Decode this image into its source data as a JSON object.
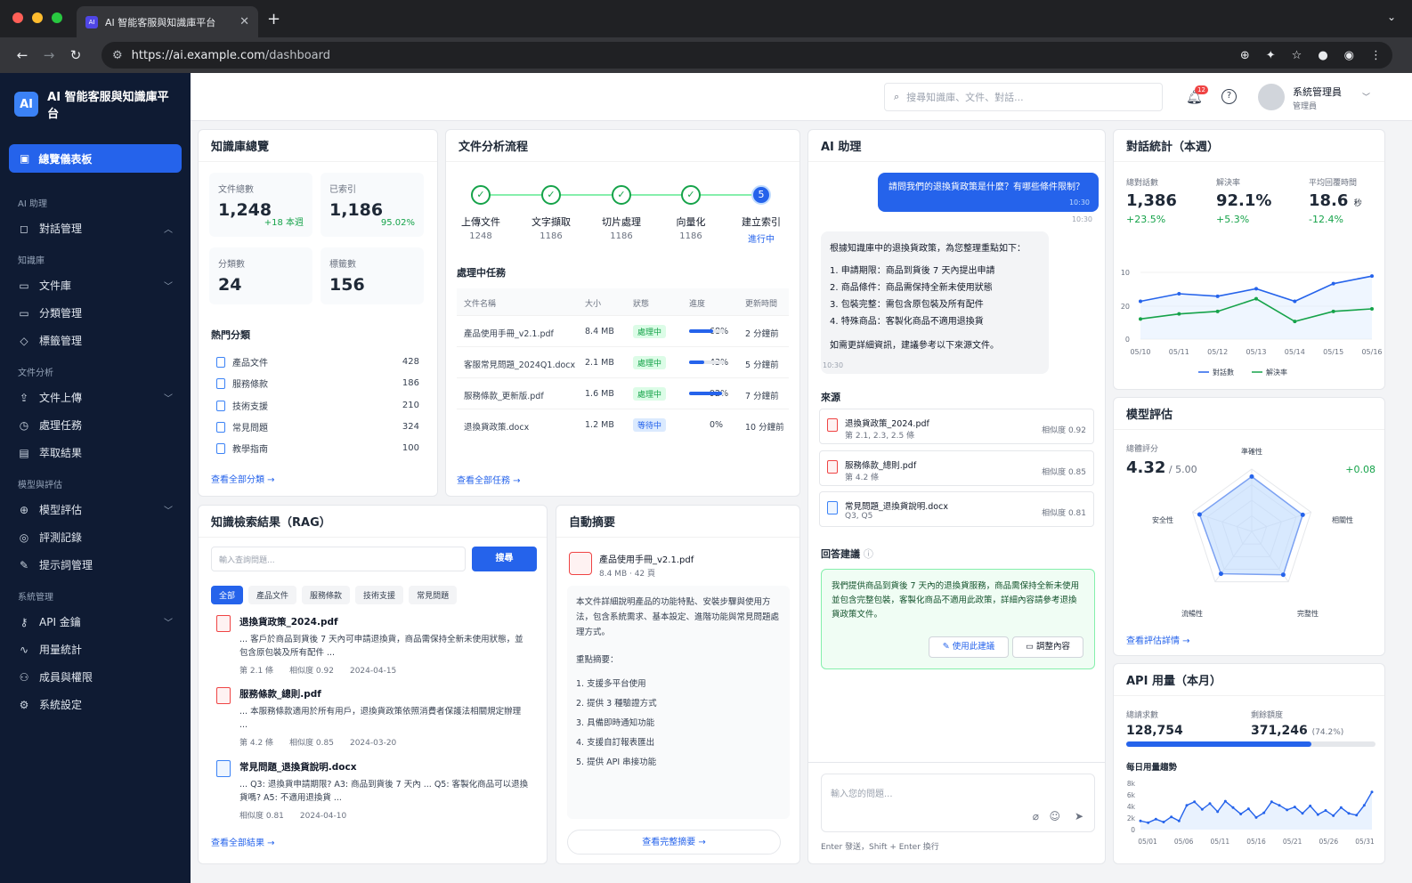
{
  "browser": {
    "tab_title": "AI 智能客服與知識庫平台",
    "favicon": "AI",
    "url_host": "https://ai.example.com",
    "url_path": "/dashboard"
  },
  "app": {
    "logo": "AI",
    "title": "AI 智能客服與知識庫平台"
  },
  "sidebar": {
    "active": "總覽儀表板",
    "sections": [
      {
        "title": "AI 助理",
        "items": [
          "對話管理"
        ]
      },
      {
        "title": "知識庫",
        "items": [
          "文件庫",
          "分類管理",
          "標籤管理"
        ]
      },
      {
        "title": "文件分析",
        "items": [
          "文件上傳",
          "處理任務",
          "萃取結果"
        ]
      },
      {
        "title": "模型與評估",
        "items": [
          "模型評估",
          "評測記錄",
          "提示詞管理"
        ]
      },
      {
        "title": "系統管理",
        "items": [
          "API 金鑰",
          "用量統計",
          "成員與權限",
          "系統設定"
        ]
      }
    ]
  },
  "topbar": {
    "search_placeholder": "搜尋知識庫、文件、對話...",
    "notif_count": "12",
    "user_name": "系統管理員",
    "user_role": "管理員"
  },
  "kb": {
    "title": "知識庫總覽",
    "total_label": "文件總數",
    "total": "1,248",
    "total_delta": "+18 本週",
    "indexed_label": "已索引",
    "indexed": "1,186",
    "indexed_pct": "95.02%",
    "cat_label": "分類數",
    "cat": "24",
    "tag_label": "標籤數",
    "tag": "156",
    "hot_title": "熱門分類",
    "hot": [
      {
        "name": "產品文件",
        "n": "428"
      },
      {
        "name": "服務條款",
        "n": "186"
      },
      {
        "name": "技術支援",
        "n": "210"
      },
      {
        "name": "常見問題",
        "n": "324"
      },
      {
        "name": "教學指南",
        "n": "100"
      }
    ],
    "link": "查看全部分類 →"
  },
  "pipeline": {
    "title": "文件分析流程",
    "steps": [
      {
        "label": "上傳文件",
        "n": "1248"
      },
      {
        "label": "文字擷取",
        "n": "1186"
      },
      {
        "label": "切片處理",
        "n": "1186"
      },
      {
        "label": "向量化",
        "n": "1186"
      },
      {
        "label": "建立索引",
        "n": "進行中"
      }
    ],
    "step5": "5",
    "tasks_title": "處理中任務",
    "headers": [
      "文件名稱",
      "大小",
      "狀態",
      "進度",
      "更新時間"
    ],
    "rows": [
      {
        "name": "產品使用手冊_v2.1.pdf",
        "size": "8.4 MB",
        "status": "處理中",
        "pct": "68%",
        "p": 68,
        "time": "2 分鐘前"
      },
      {
        "name": "客服常見問題_2024Q1.docx",
        "size": "2.1 MB",
        "status": "處理中",
        "pct": "43%",
        "p": 43,
        "time": "5 分鐘前"
      },
      {
        "name": "服務條款_更新版.pdf",
        "size": "1.6 MB",
        "status": "處理中",
        "pct": "92%",
        "p": 92,
        "time": "7 分鐘前"
      },
      {
        "name": "退換貨政策.docx",
        "size": "1.2 MB",
        "status": "等待中",
        "pct": "0%",
        "p": 0,
        "time": "10 分鐘前"
      }
    ],
    "link": "查看全部任務 →"
  },
  "assistant": {
    "title": "AI 助理",
    "user_msg": "請問我們的退換貨政策是什麼？有哪些條件限制？",
    "user_time": "10:30",
    "user_time2": "10:30",
    "reply_intro": "根據知識庫中的退換貨政策，為您整理重點如下：",
    "reply_points": [
      "1.  申請期限：商品到貨後 7 天內提出申請",
      "2.  商品條件：商品需保持全新未使用狀態",
      "3.  包裝完整：需包含原包裝及所有配件",
      "4.  特殊商品：客製化商品不適用退換貨"
    ],
    "reply_outro": "如需更詳細資訊，建議參考以下來源文件。",
    "reply_time": "10:30",
    "src_title": "來源",
    "sources": [
      {
        "name": "退換貨政策_2024.pdf",
        "sec": "第 2.1, 2.3, 2.5 條",
        "score": "相似度 0.92"
      },
      {
        "name": "服務條款_總則.pdf",
        "sec": "第 4.2 條",
        "score": "相似度 0.85"
      },
      {
        "name": "常見問題_退換貨說明.docx",
        "sec": "Q3, Q5",
        "score": "相似度 0.81"
      }
    ],
    "sugg_title": "回答建議",
    "sugg_text": "我們提供商品到貨後 7 天內的退換貨服務，商品需保持全新未使用並包含完整包裝，客製化商品不適用此政策，詳細內容請參考退換貨政策文件。",
    "use_btn": "使用此建議",
    "edit_btn": "調整內容",
    "input_placeholder": "輸入您的問題...",
    "input_hint": "Enter 發送，Shift + Enter 換行"
  },
  "conv": {
    "title": "對話統計（本週）",
    "total_label": "總對話數",
    "total": "1,386",
    "total_c": "+23.5%",
    "rate_label": "解決率",
    "rate": "92.1%",
    "rate_c": "+5.3%",
    "rt_label": "平均回覆時間",
    "rt": "18.6",
    "rt_unit": "秒",
    "rt_c": "-12.4%",
    "legend": [
      "對話數",
      "解決率"
    ]
  },
  "chart_data": [
    {
      "type": "line",
      "x": [
        "05/10",
        "05/11",
        "05/12",
        "05/13",
        "05/14",
        "05/15",
        "05/16"
      ],
      "ylim": [
        0,
        30
      ],
      "yticks": [
        "10",
        "20",
        "0"
      ],
      "series": [
        {
          "name": "對話數",
          "values": [
            15,
            18,
            17,
            20,
            15,
            22,
            25
          ]
        },
        {
          "name": "解決率",
          "values": [
            8,
            10,
            11,
            16,
            7,
            11,
            12
          ]
        }
      ]
    },
    {
      "type": "radar",
      "categories": [
        "準確性",
        "相關性",
        "完整性",
        "流暢性",
        "安全性"
      ],
      "values": [
        4.4,
        4.3,
        4.3,
        4.2,
        4.4
      ],
      "max": 5
    },
    {
      "type": "area",
      "x": [
        "05/01",
        "05/06",
        "05/11",
        "05/16",
        "05/21",
        "05/26",
        "05/31"
      ],
      "ylim": [
        0,
        8
      ],
      "yticks": [
        "8k",
        "6k",
        "4k",
        "2k",
        "0"
      ],
      "values": [
        1.5,
        1.2,
        1.8,
        1.3,
        2.2,
        1.5,
        4.2,
        4.8,
        3.5,
        4.5,
        3.1,
        4.9,
        3.8,
        2.7,
        3.6,
        2.1,
        2.9,
        4.8,
        4.2,
        3.4,
        3.9,
        2.8,
        4.1,
        2.6,
        3.3,
        2.4,
        3.8,
        2.8,
        2.5,
        4.2,
        6.5
      ]
    }
  ],
  "model": {
    "title": "模型評估",
    "score_label": "總體評分",
    "score": "4.32",
    "score_max": "/ 5.00",
    "delta": "+0.08",
    "link": "查看評估詳情 →"
  },
  "api": {
    "title": "API 用量（本月）",
    "req_label": "總請求數",
    "req": "128,754",
    "rem_label": "剩餘額度",
    "rem": "371,246",
    "rem_pct": "(74.2%)",
    "used_frac": 0.742,
    "trend_title": "每日用量趨勢"
  },
  "rag": {
    "title": "知識檢索結果（RAG）",
    "placeholder": "輸入查詢問題...",
    "button": "搜尋",
    "filters": [
      "全部",
      "產品文件",
      "服務條款",
      "技術支援",
      "常見問題"
    ],
    "results": [
      {
        "name": "退換貨政策_2024.pdf",
        "desc": "... 客戶於商品到貨後 7 天內可申請退換貨，商品需保持全新未使用狀態，並包含原包裝及所有配件 ...",
        "sec": "第 2.1 條",
        "score": "相似度 0.92",
        "date": "2024-04-15"
      },
      {
        "name": "服務條款_總則.pdf",
        "desc": "... 本服務條款適用於所有用戶，退換貨政策依照消費者保護法相關規定辦理 ...",
        "sec": "第 4.2 條",
        "score": "相似度 0.85",
        "date": "2024-03-20"
      },
      {
        "name": "常見問題_退換貨說明.docx",
        "desc": "... Q3: 退換貨申請期限? A3: 商品到貨後 7 天內 ... Q5: 客製化商品可以退換貨嗎? A5: 不適用退換貨 ...",
        "sec": "",
        "score": "相似度 0.81",
        "date": "2024-04-10"
      }
    ],
    "link": "查看全部結果 →"
  },
  "summary": {
    "title": "自動摘要",
    "file": "產品使用手冊_v2.1.pdf",
    "meta": "8.4 MB · 42 頁",
    "text": "本文件詳細說明產品的功能特點、安裝步驟與使用方法，包含系統需求、基本設定、進階功能與常見問題處理方式。",
    "points_title": "重點摘要：",
    "points": [
      "1.  支援多平台使用",
      "2.  提供 3 種驗證方式",
      "3.  具備即時通知功能",
      "4.  支援自訂報表匯出",
      "5.  提供 API 串接功能"
    ],
    "link": "查看完整摘要 →"
  }
}
